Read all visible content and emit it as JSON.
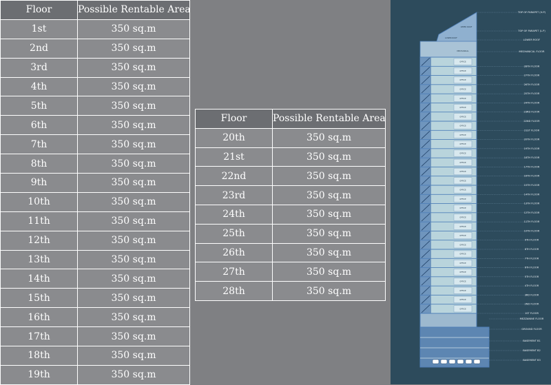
{
  "table1": {
    "header": {
      "floor": "Floor",
      "area": "Possible Rentable Area"
    },
    "rows": [
      {
        "floor": "1st",
        "area": "350 sq.m"
      },
      {
        "floor": "2nd",
        "area": "350 sq.m"
      },
      {
        "floor": "3rd",
        "area": "350 sq.m"
      },
      {
        "floor": "4th",
        "area": "350 sq.m"
      },
      {
        "floor": "5th",
        "area": "350 sq.m"
      },
      {
        "floor": "6th",
        "area": "350 sq.m"
      },
      {
        "floor": "7th",
        "area": "350 sq.m"
      },
      {
        "floor": "8th",
        "area": "350 sq.m"
      },
      {
        "floor": "9th",
        "area": "350 sq.m"
      },
      {
        "floor": "10th",
        "area": "350 sq.m"
      },
      {
        "floor": "11th",
        "area": "350 sq.m"
      },
      {
        "floor": "12th",
        "area": "350 sq.m"
      },
      {
        "floor": "13th",
        "area": "350 sq.m"
      },
      {
        "floor": "14th",
        "area": "350 sq.m"
      },
      {
        "floor": "15th",
        "area": "350 sq.m"
      },
      {
        "floor": "16th",
        "area": "350 sq.m"
      },
      {
        "floor": "17th",
        "area": "350 sq.m"
      },
      {
        "floor": "18th",
        "area": "350 sq.m"
      },
      {
        "floor": "19th",
        "area": "350 sq.m"
      }
    ]
  },
  "table2": {
    "header": {
      "floor": "Floor",
      "area": "Possible Rentable Area"
    },
    "rows": [
      {
        "floor": "20th",
        "area": "350 sq.m"
      },
      {
        "floor": "21st",
        "area": "350 sq.m"
      },
      {
        "floor": "22nd",
        "area": "350 sq.m"
      },
      {
        "floor": "23rd",
        "area": "350 sq.m"
      },
      {
        "floor": "24th",
        "area": "350 sq.m"
      },
      {
        "floor": "25th",
        "area": "350 sq.m"
      },
      {
        "floor": "26th",
        "area": "350 sq.m"
      },
      {
        "floor": "27th",
        "area": "350 sq.m"
      },
      {
        "floor": "28th",
        "area": "350 sq.m"
      }
    ]
  },
  "section": {
    "top_labels": [
      "TOP OF PARAPET (H.P)",
      "TOP OF PARAPET (L.P)",
      "UPPER ROOF",
      "LOWER ROOF",
      "MECHANICAL FLOOR"
    ],
    "roof_labels": [
      "UPPER ROOF",
      "LOWER ROOF",
      "MECHANICAL"
    ],
    "room_label": "OFFICE",
    "floor_labels": [
      "28TH FLOOR",
      "27TH FLOOR",
      "26TH FLOOR",
      "25TH FLOOR",
      "24TH FLOOR",
      "23RD FLOOR",
      "22ND FLOOR",
      "21ST FLOOR",
      "20TH FLOOR",
      "19TH FLOOR",
      "18TH FLOOR",
      "17TH FLOOR",
      "16TH FLOOR",
      "15TH FLOOR",
      "14TH FLOOR",
      "13TH FLOOR",
      "12TH FLOOR",
      "11TH FLOOR",
      "10TH FLOOR",
      "9TH FLOOR",
      "8TH FLOOR",
      "7TH FLOOR",
      "6TH FLOOR",
      "5TH FLOOR",
      "4TH FLOOR",
      "3RD FLOOR",
      "2ND FLOOR",
      "1ST FLOOR"
    ],
    "bottom_labels": [
      "MEZZANINE FLOOR",
      "GROUND FLOOR",
      "BASEMENT B1",
      "BASEMENT B2",
      "BASEMENT B3"
    ],
    "colors": {
      "background": "#2d4b5c",
      "glass": "#b9d4dc",
      "structure": "#4f7fb8",
      "label": "#e8eef2"
    }
  }
}
